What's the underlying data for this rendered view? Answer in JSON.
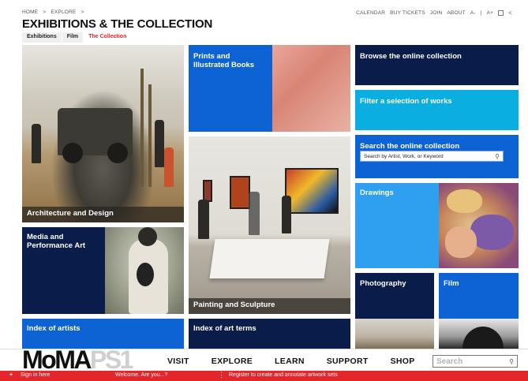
{
  "breadcrumbs": [
    "HOME",
    ">",
    "EXPLORE",
    ">"
  ],
  "utility_nav": [
    "CALENDAR",
    "BUY TICKETS",
    "JOIN",
    "ABOUT",
    "A-",
    "|",
    "A+"
  ],
  "page_title": "EXHIBITIONS & THE COLLECTION",
  "subtabs": [
    {
      "label": "Exhibitions",
      "active": false
    },
    {
      "label": "Film",
      "active": false
    },
    {
      "label": "The Collection",
      "active": true
    }
  ],
  "tiles": {
    "architecture": "Architecture and Design",
    "prints": "Prints and Illustrated Books",
    "browse": "Browse the online collection",
    "filter": "Filter a selection of works",
    "search": "Search the online collection",
    "search_placeholder": "Search by Artist, Work, or Keyword",
    "drawings": "Drawings",
    "media": "Media and Performance Art",
    "painting": "Painting and Sculpture",
    "photography": "Photography",
    "film": "Film",
    "index_artists": "Index of artists",
    "index_terms": "Index of art terms"
  },
  "logo": {
    "moma": "MoMA",
    "ps1": "PS1"
  },
  "main_nav": [
    "VISIT",
    "EXPLORE",
    "LEARN",
    "SUPPORT",
    "SHOP"
  ],
  "footer_search_placeholder": "Search",
  "bottom_bar": {
    "sign_in": "Sign in here",
    "welcome": "Welcome. Are you...?",
    "register": "Register to create and annotate artwork sets"
  },
  "colors": {
    "accent_red": "#e4262b",
    "navy": "#0a1c4a",
    "blue": "#0e63d4",
    "cyan": "#0aaee0"
  }
}
